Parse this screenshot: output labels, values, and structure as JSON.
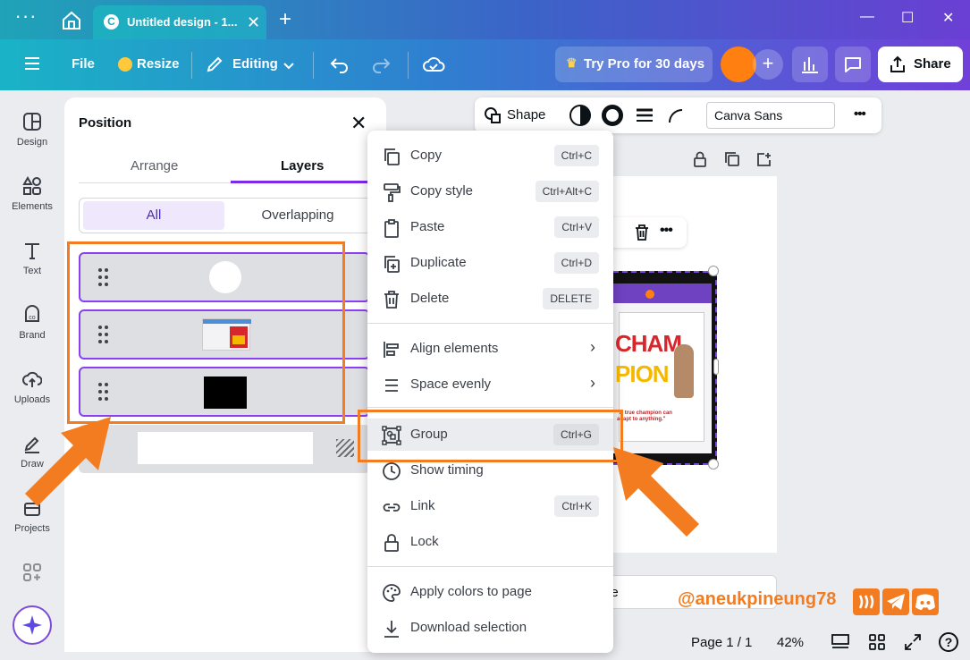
{
  "titlebar": {
    "tab_title": "Untitled design - 1...",
    "tab_logo": "C",
    "close_symbol": "✕",
    "new_tab_symbol": "+",
    "minimize_symbol": "—",
    "maximize_symbol": "☐",
    "window_close_symbol": "✕"
  },
  "toolbar": {
    "file_label": "File",
    "resize_label": "Resize",
    "editing_label": "Editing",
    "pro_label": "Try Pro for 30 days",
    "share_label": "Share",
    "add_symbol": "+"
  },
  "rail": {
    "items": [
      {
        "label": "Design",
        "icon": "design-icon"
      },
      {
        "label": "Elements",
        "icon": "elements-icon"
      },
      {
        "label": "Text",
        "icon": "text-icon"
      },
      {
        "label": "Brand",
        "icon": "brand-icon"
      },
      {
        "label": "Uploads",
        "icon": "uploads-icon"
      },
      {
        "label": "Draw",
        "icon": "draw-icon"
      },
      {
        "label": "Projects",
        "icon": "projects-icon"
      }
    ]
  },
  "panel": {
    "title": "Position",
    "close_symbol": "✕",
    "tabs": [
      "Arrange",
      "Layers"
    ],
    "active_tab": "Layers",
    "filters": [
      "All",
      "Overlapping"
    ]
  },
  "shapebar": {
    "shape_label": "Shape",
    "font_name": "Canva Sans",
    "more_symbol": "•••"
  },
  "context_menu": {
    "items": [
      {
        "label": "Copy",
        "shortcut": "Ctrl+C",
        "icon": "copy-icon"
      },
      {
        "label": "Copy style",
        "shortcut": "Ctrl+Alt+C",
        "icon": "paint-roller-icon"
      },
      {
        "label": "Paste",
        "shortcut": "Ctrl+V",
        "icon": "clipboard-icon"
      },
      {
        "label": "Duplicate",
        "shortcut": "Ctrl+D",
        "icon": "duplicate-icon"
      },
      {
        "label": "Delete",
        "shortcut": "DELETE",
        "icon": "trash-icon"
      },
      {
        "label": "Align elements",
        "icon": "align-icon"
      },
      {
        "label": "Space evenly",
        "icon": "space-evenly-icon"
      },
      {
        "label": "Group",
        "shortcut": "Ctrl+G",
        "icon": "group-icon"
      },
      {
        "label": "Show timing",
        "icon": "clock-icon"
      },
      {
        "label": "Link",
        "shortcut": "Ctrl+K",
        "icon": "link-icon"
      },
      {
        "label": "Lock",
        "icon": "lock-icon"
      },
      {
        "label": "Apply colors to page",
        "icon": "palette-icon"
      },
      {
        "label": "Download selection",
        "icon": "download-icon"
      }
    ],
    "submenu_symbol": "›"
  },
  "design_preview": {
    "headline_1": "CHAM",
    "headline_2": "PION",
    "quote": "\"A true champion can adapt to anything.\""
  },
  "footer": {
    "notes_partial": "ge",
    "page_info": "Page 1 / 1",
    "zoom": "42%",
    "help_symbol": "?"
  },
  "watermark": {
    "handle": "@aneukpineung78"
  },
  "colors": {
    "accent": "#7d2ae8",
    "annotation": "#f47c20",
    "avatar": "#ff7f11"
  }
}
